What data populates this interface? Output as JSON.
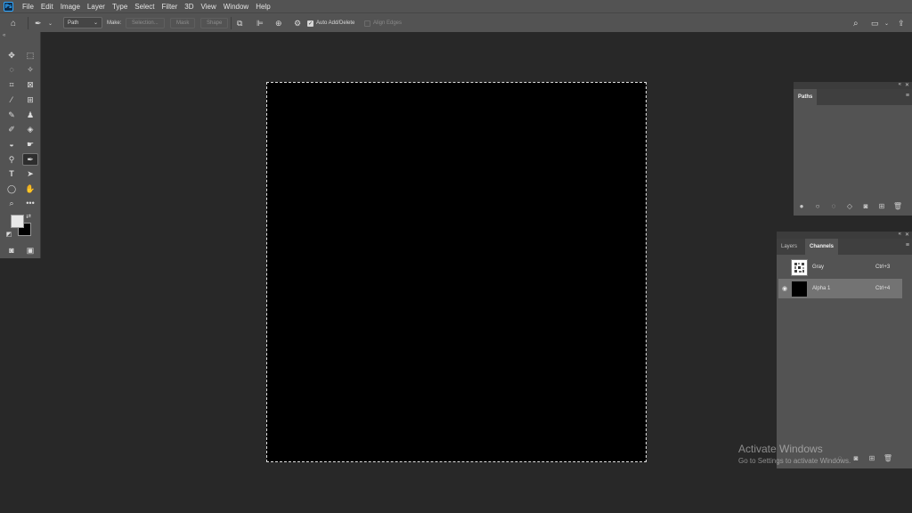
{
  "menubar": {
    "items": [
      "File",
      "Edit",
      "Image",
      "Layer",
      "Type",
      "Select",
      "Filter",
      "3D",
      "View",
      "Window",
      "Help"
    ]
  },
  "options": {
    "mode": "Path",
    "make_label": "Make:",
    "selection_label": "Selection...",
    "mask_label": "Mask",
    "shape_label": "Shape",
    "auto_add_delete": "Auto Add/Delete",
    "align_edges": "Align Edges"
  },
  "paths_panel": {
    "tab": "Paths"
  },
  "channels_panel": {
    "tabs": [
      "Layers",
      "Channels"
    ],
    "active_tab": "Channels",
    "rows": [
      {
        "name": "Gray",
        "shortcut": "Ctrl+3",
        "visible": false
      },
      {
        "name": "Alpha 1",
        "shortcut": "Ctrl+4",
        "visible": true
      }
    ]
  },
  "watermark": {
    "title": "Activate Windows",
    "subtitle": "Go to Settings to activate Windows."
  },
  "colors": {
    "app_bg": "#282828",
    "chrome": "#535353",
    "canvas": "#000000",
    "foreground_swatch": "#e8e8e8",
    "background_swatch": "#000000",
    "accent": "#31a8ff"
  }
}
